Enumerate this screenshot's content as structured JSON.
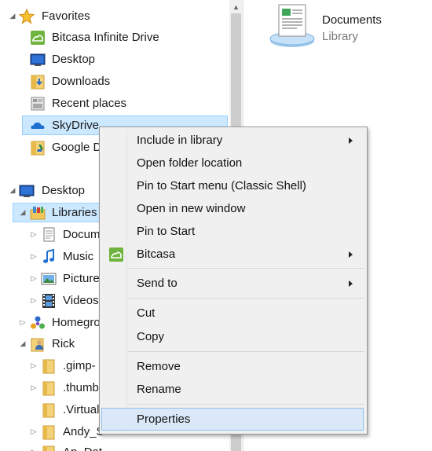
{
  "nav_pane": {
    "favorites": {
      "label": "Favorites",
      "items": [
        {
          "label": "Bitcasa Infinite Drive",
          "icon": "bitcasa-icon"
        },
        {
          "label": "Desktop",
          "icon": "desktop-icon"
        },
        {
          "label": "Downloads",
          "icon": "downloads-folder-icon"
        },
        {
          "label": "Recent places",
          "icon": "recent-places-icon"
        },
        {
          "label": "SkyDrive",
          "icon": "skydrive-icon"
        },
        {
          "label": "Google D",
          "icon": "google-drive-folder-icon"
        }
      ]
    },
    "desktop": {
      "label": "Desktop"
    },
    "libraries": {
      "label": "Libraries",
      "items": [
        {
          "label": "Docum",
          "icon": "documents-library-icon"
        },
        {
          "label": "Music",
          "icon": "music-library-icon"
        },
        {
          "label": "Picture",
          "icon": "pictures-library-icon"
        },
        {
          "label": "Videos",
          "icon": "videos-library-icon"
        }
      ]
    },
    "homegroup": {
      "label": "Homegro"
    },
    "rick": {
      "label": "Rick",
      "items": [
        {
          "label": ".gimp-"
        },
        {
          "label": ".thumb"
        },
        {
          "label": ".Virtual"
        },
        {
          "label": "Andy_S"
        },
        {
          "label": "Ap_Dat"
        }
      ]
    }
  },
  "content_pane": {
    "item_name": "Documents",
    "item_type": "Library"
  },
  "context_menu": {
    "items": [
      {
        "label": "Include in library",
        "submenu": true
      },
      {
        "label": "Open folder location"
      },
      {
        "label": "Pin to Start menu (Classic Shell)"
      },
      {
        "label": "Open in new window"
      },
      {
        "label": "Pin to Start"
      },
      {
        "label": "Bitcasa",
        "submenu": true,
        "icon": "bitcasa-icon"
      },
      {
        "label": "Send to",
        "submenu": true
      },
      {
        "label": "Cut"
      },
      {
        "label": "Copy"
      },
      {
        "label": "Remove"
      },
      {
        "label": "Rename"
      },
      {
        "label": "Properties",
        "highlighted": true
      }
    ]
  },
  "colors": {
    "selection_bg": "#cce8ff",
    "menu_bg": "#f0f0f0",
    "menu_highlight": "#dae8f8",
    "bitcasa_green": "#6fb43f"
  }
}
